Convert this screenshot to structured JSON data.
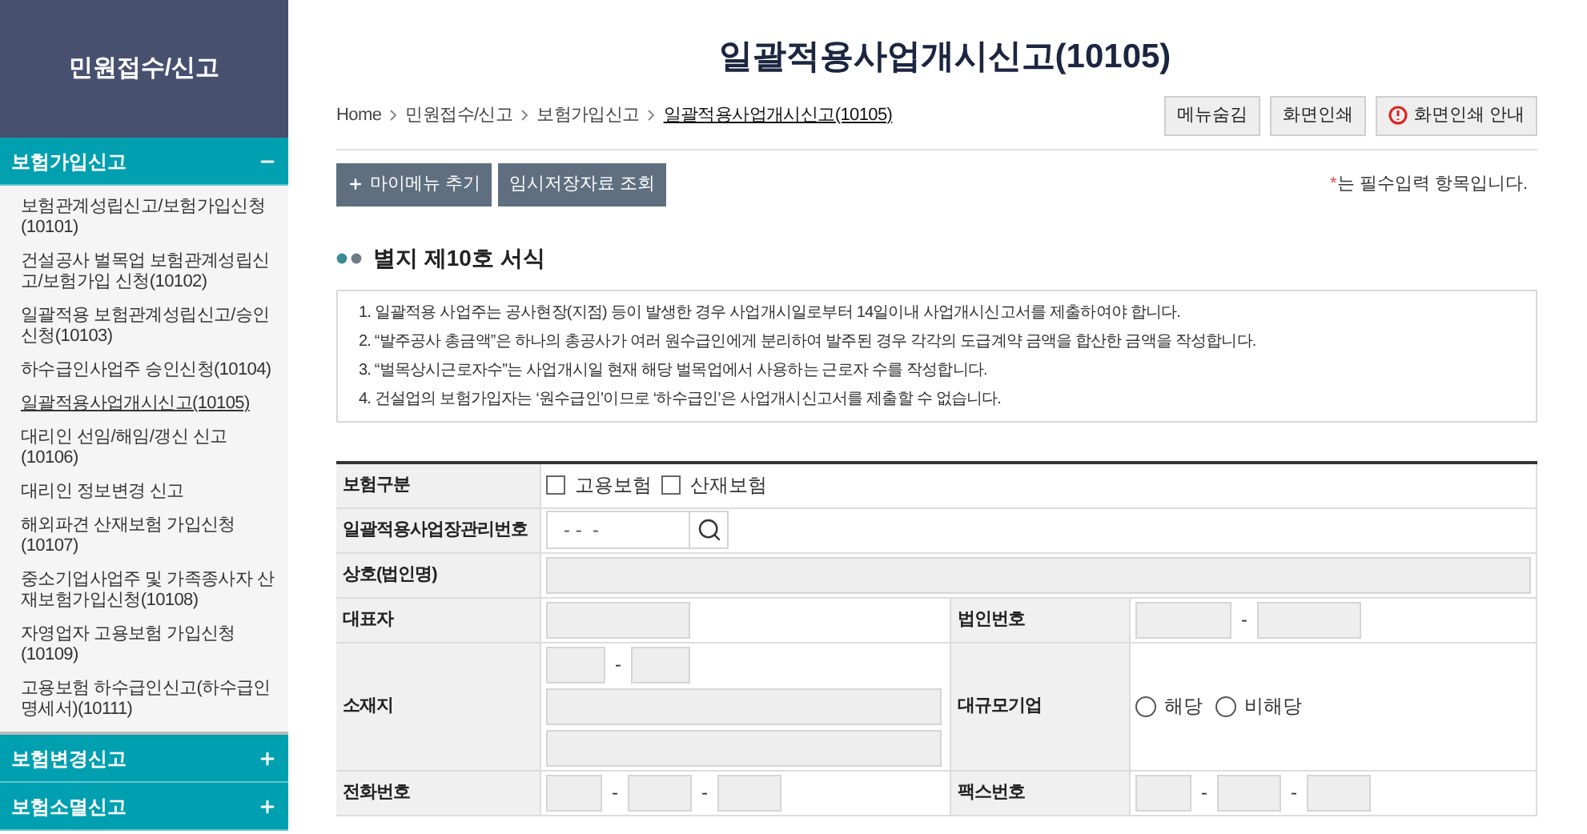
{
  "sidebar": {
    "title": "민원접수/신고",
    "sections": [
      {
        "label": "보험가입신고",
        "expanded": true,
        "items": [
          {
            "label": "보험관계성립신고/보험가입신청(10101)",
            "selected": false
          },
          {
            "label": "건설공사 벌목업 보험관계성립신고/보험가입 신청(10102)",
            "selected": false
          },
          {
            "label": "일괄적용 보험관계성립신고/승인신청(10103)",
            "selected": false
          },
          {
            "label": "하수급인사업주 승인신청(10104)",
            "selected": false
          },
          {
            "label": "일괄적용사업개시신고(10105)",
            "selected": true
          },
          {
            "label": "대리인 선임/해임/갱신 신고(10106)",
            "selected": false
          },
          {
            "label": "대리인 정보변경 신고",
            "selected": false
          },
          {
            "label": "해외파견 산재보험 가입신청(10107)",
            "selected": false
          },
          {
            "label": "중소기업사업주 및 가족종사자 산재보험가입신청(10108)",
            "selected": false
          },
          {
            "label": "자영업자 고용보험 가입신청(10109)",
            "selected": false
          },
          {
            "label": "고용보험 하수급인신고(하수급인 명세서)(10111)",
            "selected": false
          }
        ]
      },
      {
        "label": "보험변경신고",
        "expanded": false
      },
      {
        "label": "보험소멸신고",
        "expanded": false
      }
    ]
  },
  "page_title": "일괄적용사업개시신고(10105)",
  "breadcrumb": [
    "Home",
    "민원접수/신고",
    "보험가입신고",
    "일괄적용사업개시신고(10105)"
  ],
  "top_buttons": [
    {
      "label": "메뉴숨김",
      "icon": false
    },
    {
      "label": "화면인쇄",
      "icon": false
    },
    {
      "label": "화면인쇄 안내",
      "icon": true
    }
  ],
  "action_buttons": [
    {
      "label": "마이메뉴 추기",
      "plus": true
    },
    {
      "label": "임시저장자료 조회",
      "plus": false
    }
  ],
  "required_note": {
    "mark": "*",
    "text": "는 필수입력 항목입니다."
  },
  "section_title": "별지 제10호 서식",
  "notices": [
    "1. 일괄적용 사업주는 공사현장(지점) 등이 발생한 경우 사업개시일로부터 14일이내 사업개시신고서를 제출하여야 합니다.",
    "2. “발주공사 총금액”은 하나의 총공사가 여러 원수급인에게 분리하여 발주된 경우 각각의 도급계약 금액을 합산한 금액을 작성합니다.",
    "3. “벌목상시근로자수”는 사업개시일 현재 해당 벌목업에서 사용하는 근로자 수를 작성합니다.",
    "4. 건설업의 보험가입자는 ‘원수급인’이므로 ‘하수급인’은 사업개시신고서를 제출할 수 없습니다."
  ],
  "form_rows": [
    {
      "kind": "checks",
      "label": "보험구분",
      "options": [
        {
          "label": "고용보험",
          "checked": false
        },
        {
          "label": "산재보험",
          "checked": false
        }
      ]
    },
    {
      "kind": "search",
      "label": "일괄적용사업장관리번호",
      "placeholder": "- -  -"
    },
    {
      "kind": "wide",
      "label": "상호(법인명)"
    },
    {
      "kind": "split",
      "cells": [
        {
          "label": "대표자",
          "kind": "single"
        },
        {
          "label": "법인번호",
          "kind": "pair",
          "sep": "-"
        }
      ]
    },
    {
      "kind": "split",
      "cells": [
        {
          "label": "소재지",
          "kind": "address",
          "sep": "-"
        },
        {
          "label": "대규모기업",
          "kind": "radios",
          "options": [
            {
              "label": "해당",
              "selected": false
            },
            {
              "label": "비해당",
              "selected": false
            }
          ]
        }
      ]
    },
    {
      "kind": "split",
      "cells": [
        {
          "label": "전화번호",
          "kind": "triple",
          "sep": "-"
        },
        {
          "label": "팩스번호",
          "kind": "triple",
          "sep": "-"
        }
      ]
    }
  ]
}
